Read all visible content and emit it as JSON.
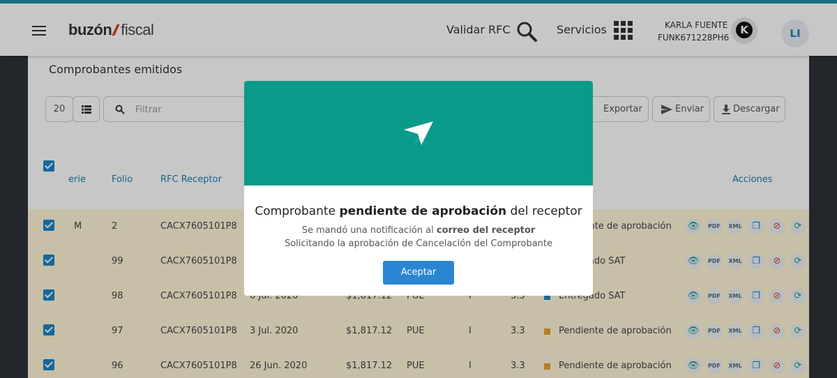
{
  "header": {
    "logo_bold": "buzón",
    "logo_light": "fiscal",
    "validar_label": "Validar RFC",
    "servicios_label": "Servicios",
    "user_name": "KARLA FUENTE",
    "user_rfc": "FUNK671228PH6",
    "avatar_k": "K",
    "avatar_initials": "LI"
  },
  "page": {
    "title": "Comprobantes emitidos"
  },
  "toolbar": {
    "page_size": "20",
    "filter_placeholder": "Filtrar",
    "export_label": "Exportar",
    "send_label": "Enviar",
    "download_label": "Descargar"
  },
  "table": {
    "headers": {
      "serie": "erie",
      "folio": "Folio",
      "rfc": "RFC Receptor",
      "acciones": "Acciones"
    },
    "rows": [
      {
        "serie": "M",
        "folio": "2",
        "rfc": "CACX7605101P8",
        "fecha": "",
        "total": "",
        "metodo": "",
        "tipo": "",
        "version": "",
        "status": "Pendiente de aprobación",
        "status_color": "#e8a030"
      },
      {
        "serie": "",
        "folio": "99",
        "rfc": "CACX7605101P8",
        "fecha": "",
        "total": "",
        "metodo": "",
        "tipo": "",
        "version": "",
        "status": "Entregado SAT",
        "status_color": "#1a86c8"
      },
      {
        "serie": "",
        "folio": "98",
        "rfc": "CACX7605101P8",
        "fecha": "6 Jul. 2020",
        "total": "$1,817.12",
        "metodo": "PUE",
        "tipo": "I",
        "version": "3.3",
        "status": "Entregado SAT",
        "status_color": "#1a86c8"
      },
      {
        "serie": "",
        "folio": "97",
        "rfc": "CACX7605101P8",
        "fecha": "3 Jul. 2020",
        "total": "$1,817.12",
        "metodo": "PUE",
        "tipo": "I",
        "version": "3.3",
        "status": "Pendiente de aprobación",
        "status_color": "#e8a030"
      },
      {
        "serie": "",
        "folio": "96",
        "rfc": "CACX7605101P8",
        "fecha": "26 Jun. 2020",
        "total": "$1,817.12",
        "metodo": "PUE",
        "tipo": "I",
        "version": "3.3",
        "status": "Pendiente de aprobación",
        "status_color": "#e8a030"
      }
    ],
    "action_pdf": "PDF",
    "action_xml": "XML"
  },
  "modal": {
    "title_pre": "Comprobante ",
    "title_bold": "pendiente de aprobación",
    "title_post": " del receptor",
    "line1_pre": "Se mandó una notificación al ",
    "line1_bold": "correo del receptor",
    "line2": "Solicitando la aprobación de Cancelación del Comprobante",
    "button": "Aceptar"
  }
}
